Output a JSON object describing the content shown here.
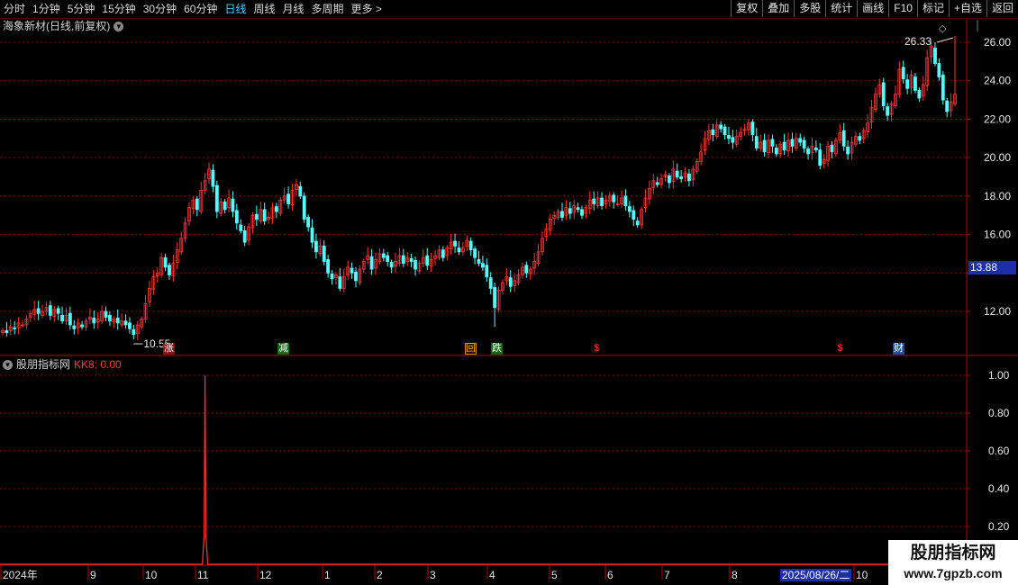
{
  "toolbar": {
    "periods": [
      "分时",
      "1分钟",
      "5分钟",
      "15分钟",
      "30分钟",
      "60分钟",
      "日线",
      "周线",
      "月线",
      "多周期",
      "更多 >"
    ],
    "active_period": "日线",
    "functions": [
      "复权",
      "叠加",
      "多股",
      "统计",
      "画线",
      "F10",
      "标记",
      "+自选",
      "返回"
    ]
  },
  "chart": {
    "title": "海象新材(日线,前复权)",
    "high_label": "26.33",
    "low_label": "10.55",
    "current_price": "13.88",
    "y_ticks": [
      "26.00",
      "24.00",
      "22.00",
      "20.00",
      "18.00",
      "16.00",
      "12.00"
    ],
    "signals": [
      "涨",
      "减",
      "回",
      "跌",
      "$",
      "$",
      "财"
    ]
  },
  "indicator": {
    "name": "股朋指标网",
    "value_label": "KK8: 0.00",
    "y_ticks": [
      "1.00",
      "0.80",
      "0.60",
      "0.40",
      "0.20"
    ]
  },
  "x_axis": {
    "labels": [
      "2024年",
      "9",
      "10",
      "11",
      "12",
      "1",
      "2",
      "3",
      "4",
      "5",
      "6",
      "7",
      "8",
      "10"
    ],
    "highlighted_date": "2025/08/26/二"
  },
  "watermark": {
    "title": "股朋指标网",
    "url": "www.7gpzb.com"
  },
  "colors": {
    "up": "#ff3232",
    "down": "#54ffff",
    "background": "#000000",
    "grid": "#8b0000",
    "axis": "#b00000",
    "highlight": "#1c2ea8"
  },
  "chart_data": {
    "type": "candlestick",
    "price_range": [
      10.55,
      26.33
    ],
    "closes": [
      11.0,
      10.9,
      11.2,
      11.1,
      11.4,
      11.3,
      11.6,
      11.9,
      12.1,
      11.9,
      12.0,
      12.2,
      11.8,
      12.1,
      11.9,
      11.5,
      11.8,
      11.3,
      11.1,
      11.4,
      11.2,
      11.5,
      11.7,
      11.4,
      11.6,
      12.0,
      11.7,
      11.5,
      11.6,
      11.4,
      11.5,
      11.3,
      11.1,
      10.8,
      11.3,
      11.6,
      12.4,
      13.2,
      13.8,
      14.0,
      14.8,
      14.3,
      13.9,
      14.5,
      15.2,
      15.8,
      16.6,
      17.4,
      17.8,
      17.3,
      18.3,
      18.8,
      19.4,
      18.5,
      17.2,
      17.7,
      17.3,
      17.9,
      17.2,
      16.6,
      16.2,
      15.6,
      16.4,
      17.0,
      16.8,
      17.3,
      16.7,
      16.9,
      17.4,
      17.2,
      17.8,
      18.0,
      17.6,
      18.3,
      18.6,
      18.0,
      16.8,
      16.4,
      15.6,
      15.1,
      15.4,
      14.6,
      14.0,
      13.7,
      13.9,
      13.2,
      13.8,
      14.3,
      14.0,
      13.6,
      14.2,
      14.6,
      14.9,
      14.2,
      14.7,
      15.0,
      14.8,
      14.6,
      14.3,
      14.6,
      14.9,
      14.5,
      14.8,
      14.6,
      14.2,
      14.5,
      14.8,
      14.4,
      14.7,
      14.9,
      15.2,
      14.8,
      15.3,
      15.6,
      15.4,
      15.1,
      15.3,
      15.7,
      15.2,
      14.8,
      14.5,
      14.3,
      13.8,
      13.2,
      12.2,
      13.1,
      13.5,
      13.8,
      13.3,
      13.6,
      13.9,
      14.3,
      14.0,
      14.2,
      14.6,
      15.1,
      15.8,
      16.3,
      16.8,
      17.0,
      17.2,
      16.9,
      17.4,
      17.1,
      17.5,
      17.3,
      17.0,
      17.4,
      17.8,
      17.6,
      17.9,
      17.5,
      17.8,
      18.0,
      17.7,
      17.6,
      17.9,
      17.5,
      17.2,
      16.8,
      16.5,
      17.3,
      17.9,
      18.4,
      18.8,
      18.6,
      18.9,
      19.1,
      18.7,
      19.4,
      19.0,
      18.9,
      19.2,
      18.8,
      19.4,
      19.8,
      20.3,
      21.0,
      21.4,
      21.2,
      21.7,
      21.5,
      21.2,
      21.0,
      20.8,
      21.1,
      21.3,
      21.5,
      21.8,
      21.2,
      20.5,
      20.8,
      20.3,
      20.9,
      20.6,
      20.2,
      20.7,
      20.4,
      20.9,
      20.6,
      21.0,
      20.8,
      20.5,
      20.2,
      20.6,
      20.4,
      19.6,
      19.9,
      20.6,
      20.3,
      20.9,
      21.3,
      20.6,
      20.2,
      20.8,
      21.1,
      20.9,
      21.4,
      21.8,
      22.6,
      23.3,
      23.8,
      22.7,
      22.2,
      22.8,
      23.3,
      24.6,
      24.1,
      23.6,
      24.3,
      23.5,
      23.1,
      23.8,
      25.2,
      25.8,
      24.9,
      24.2,
      23.0,
      22.4,
      22.9,
      23.3
    ]
  },
  "indicator_data": {
    "type": "line",
    "spike_index": 51,
    "spike_value": 1.0,
    "baseline": 0.0
  }
}
